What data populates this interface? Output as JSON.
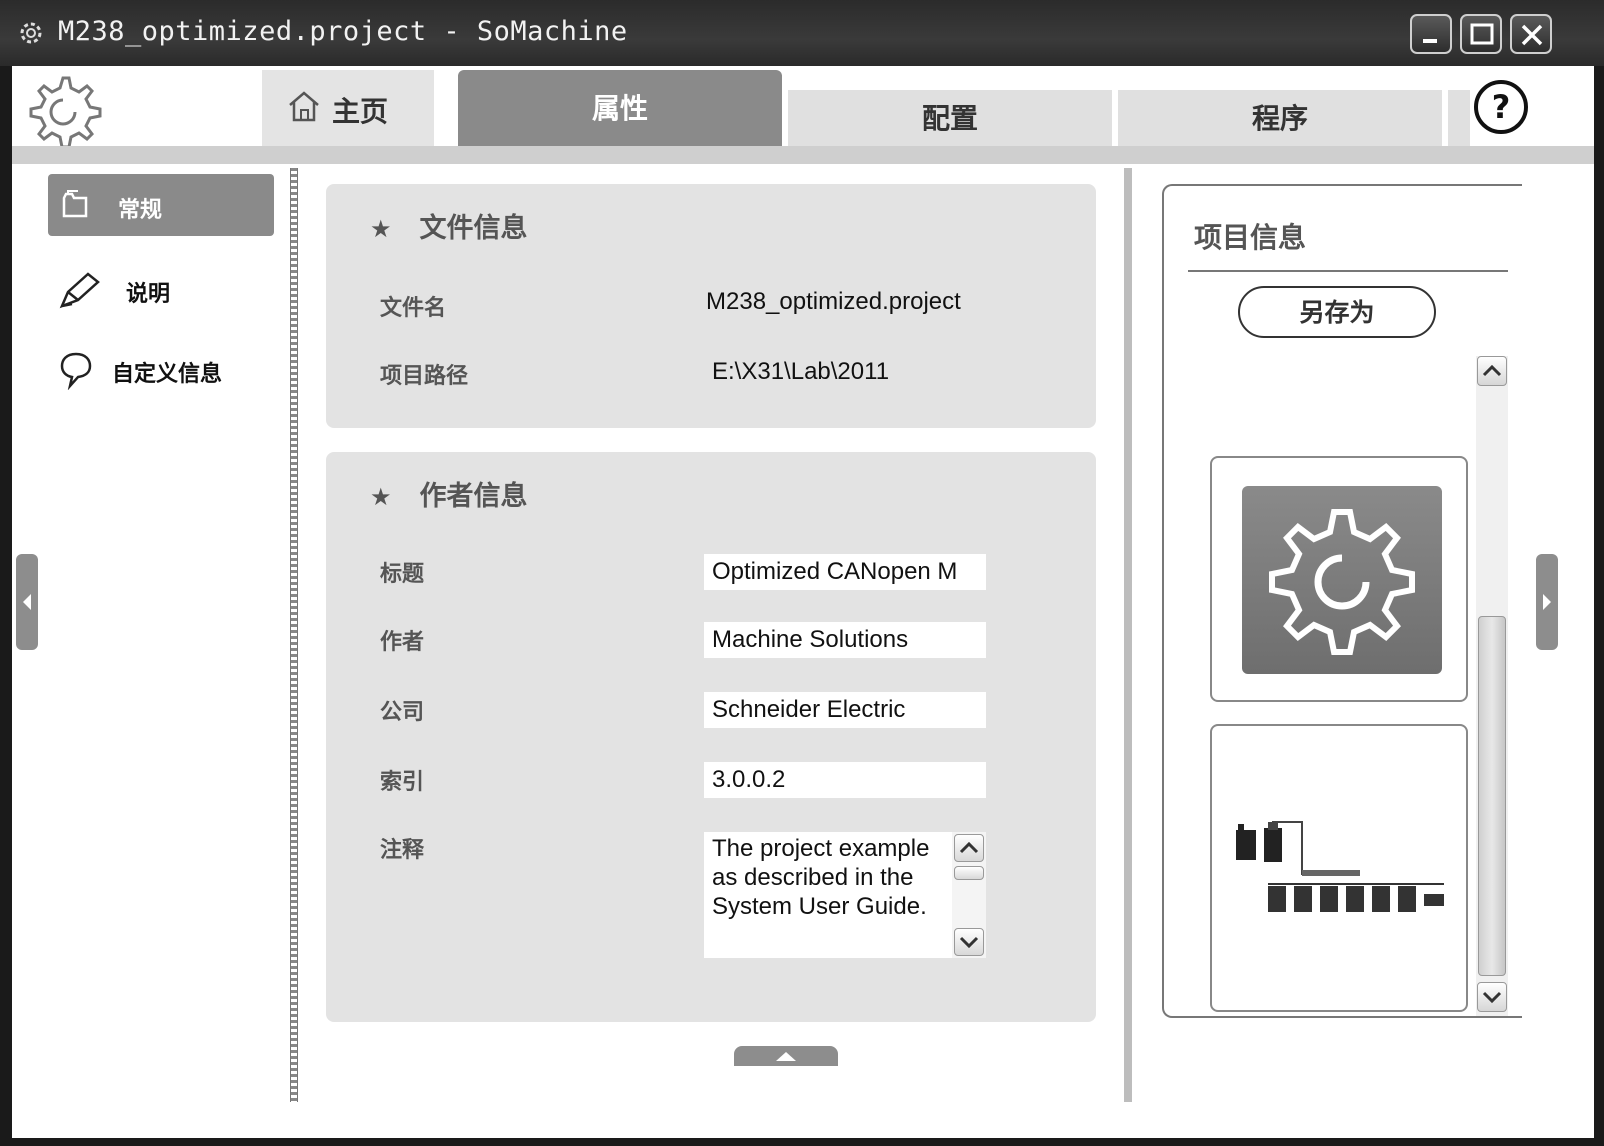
{
  "window": {
    "title": "M238_optimized.project - SoMachine"
  },
  "tabs": {
    "home": "主页",
    "properties": "属性",
    "configuration": "配置",
    "program": "程序"
  },
  "nav": {
    "general": "常规",
    "description": "说明",
    "custom_info": "自定义信息"
  },
  "file_info": {
    "title": "文件信息",
    "filename_label": "文件名",
    "filename_value": "M238_optimized.project",
    "path_label": "项目路径",
    "path_value": "E:\\X31\\Lab\\2011"
  },
  "author_info": {
    "title": "作者信息",
    "title_label": "标题",
    "title_value": "Optimized CANopen M",
    "author_label": "作者",
    "author_value": "Machine Solutions",
    "company_label": "公司",
    "company_value": "Schneider Electric",
    "index_label": "索引",
    "index_value": "3.0.0.2",
    "comment_label": "注释",
    "comment_value": "The project example as described in the System User Guide."
  },
  "project_info": {
    "title": "项目信息",
    "save_as": "另存为"
  },
  "icons": {
    "app": "gear-icon",
    "help": "help-icon",
    "home": "home-icon",
    "general": "folder-icon",
    "description": "pen-icon",
    "custom": "bubble-icon"
  },
  "colors": {
    "titlebar": "#2e2e2e",
    "active_tab": "#8a8a8a",
    "panel": "#e3e3e3"
  }
}
